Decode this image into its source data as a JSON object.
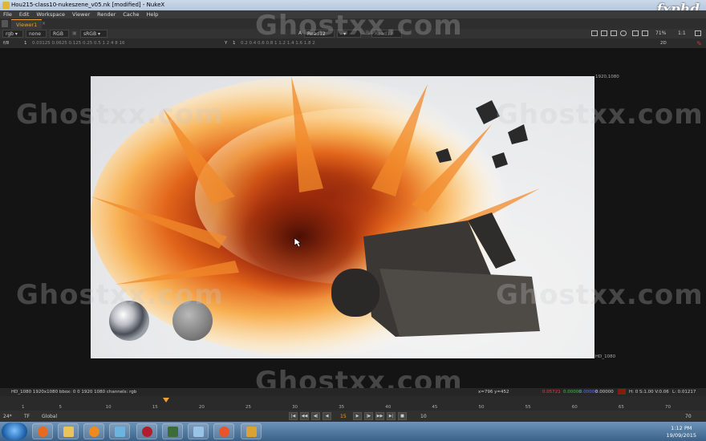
{
  "window": {
    "title": "Hou215-class10-nukeszene_v05.nk [modified] - NukeX",
    "brand": "fxphd"
  },
  "menu": [
    "File",
    "Edit",
    "Workspace",
    "Viewer",
    "Render",
    "Cache",
    "Help"
  ],
  "viewer_tab": {
    "label": "Viewer1",
    "close": "×"
  },
  "toolbar": {
    "channels": "rgb",
    "alpha": "none",
    "colorspace": "RGB",
    "lut": "sRGB",
    "input_a_prefix": "A",
    "input_a": "Read12",
    "dash": "-",
    "input_b_prefix": "B",
    "input_b": "Read12",
    "zoom": "71%",
    "proxy": "1:1"
  },
  "toolbar2": {
    "fstop": "f/8",
    "fstop_value": "1",
    "gain_ticks": "0.03125 0.0625 0.125 0.25 0.5 1 2 4 8 16",
    "gamma_prefix": "Y",
    "gamma_value": "1",
    "gamma_ticks": "0.2 0.4 0.6 0.8 1 1.2 1.4 1.6 1.8 2",
    "view_mode": "2D"
  },
  "viewer": {
    "format_top_right": "1920,1080",
    "format_bottom_right": "HD_1080",
    "watermark_text": "Ghostxx.com"
  },
  "infobar": {
    "format_info": "HD_1080 1920x1080  bbox: 0 0 1920 1080 channels: rgb",
    "coords": "x=796 y=452",
    "pixel_r": "0.05721",
    "pixel_g": "0.00000",
    "pixel_b": "0.00000",
    "pixel_a": "0.00000",
    "hsv": "H: 0 S:1.00 V:0.06",
    "luminance": "L: 0.01217"
  },
  "timeline": {
    "ticks": [
      "1",
      "5",
      "10",
      "15",
      "20",
      "25",
      "30",
      "35",
      "40",
      "45",
      "50",
      "55",
      "60",
      "65",
      "70"
    ],
    "current_frame": 15,
    "last_frame": "70"
  },
  "playback": {
    "fps": "24*",
    "tf": "TF",
    "range_mode": "Global",
    "frame": "15",
    "increment": "10",
    "end_frame": "70"
  },
  "taskbar": {
    "time": "1:12 PM",
    "date": "19/09/2015"
  }
}
